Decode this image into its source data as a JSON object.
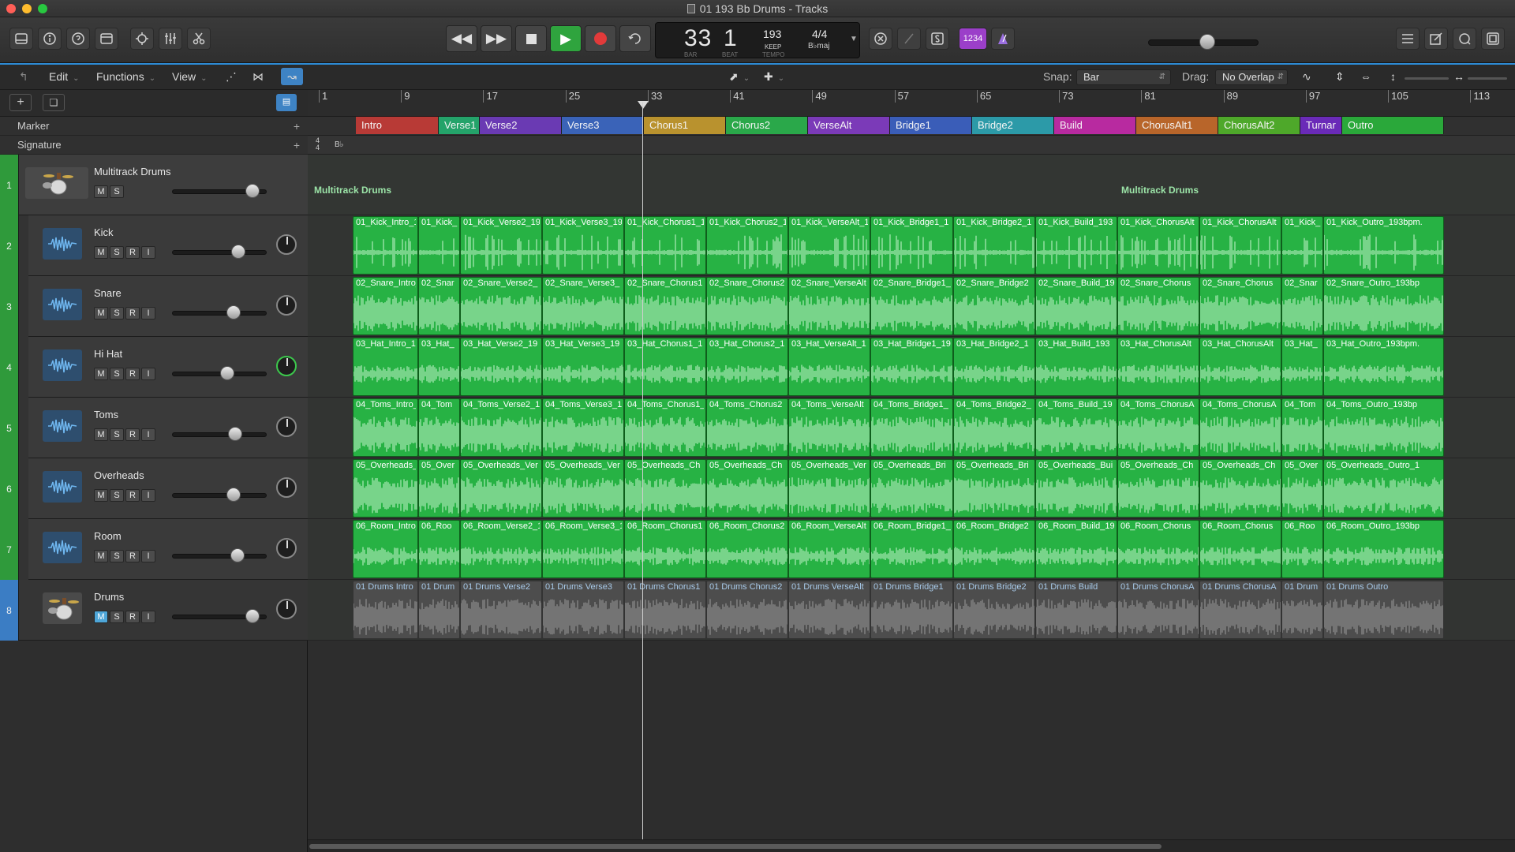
{
  "window": {
    "title": "01 193 Bb Drums - Tracks"
  },
  "transport": {
    "bar": "33",
    "beat": "1",
    "bar_label": "BAR",
    "beat_label": "BEAT",
    "tempo": "193",
    "tempo_mode": "KEEP",
    "tempo_label": "TEMPO",
    "time_signature": "4/4",
    "key": "B♭maj",
    "cycle_count_label": "1234"
  },
  "toolbar": {
    "edit": "Edit",
    "functions": "Functions",
    "view": "View",
    "snap_label": "Snap:",
    "snap_value": "Bar",
    "drag_label": "Drag:",
    "drag_value": "No Overlap"
  },
  "global_tracks": {
    "marker": "Marker",
    "signature": "Signature",
    "signature_value": "4\n4",
    "signature_key": "B♭"
  },
  "ruler": {
    "bars": [
      "1",
      "9",
      "17",
      "25",
      "33",
      "41",
      "49",
      "57",
      "65",
      "73",
      "81",
      "89",
      "97",
      "105",
      "113"
    ]
  },
  "markers": [
    {
      "name": "Intro",
      "color": "#b83a36"
    },
    {
      "name": "Verse1",
      "color": "#24a36a"
    },
    {
      "name": "Verse2",
      "color": "#6a3ab3"
    },
    {
      "name": "Verse3",
      "color": "#3a63b8"
    },
    {
      "name": "Chorus1",
      "color": "#b9922e"
    },
    {
      "name": "Chorus2",
      "color": "#2aa84a"
    },
    {
      "name": "VerseAlt",
      "color": "#7b3ab8"
    },
    {
      "name": "Bridge1",
      "color": "#3a5db8"
    },
    {
      "name": "Bridge2",
      "color": "#2c9aa8"
    },
    {
      "name": "Build",
      "color": "#b82aa0"
    },
    {
      "name": "ChorusAlt1",
      "color": "#b8652a"
    },
    {
      "name": "ChorusAlt2",
      "color": "#4ea82a"
    },
    {
      "name": "Turnar",
      "color": "#6a2ab8"
    },
    {
      "name": "Outro",
      "color": "#2aa83a"
    }
  ],
  "tracks": [
    {
      "num": "1",
      "name": "Multitrack Drums",
      "type": "folder",
      "buttons": [
        "M",
        "S"
      ],
      "fader": 0.85
    },
    {
      "num": "2",
      "name": "Kick",
      "type": "audio",
      "buttons": [
        "M",
        "S",
        "R",
        "I"
      ],
      "fader": 0.7
    },
    {
      "num": "3",
      "name": "Snare",
      "type": "audio",
      "buttons": [
        "M",
        "S",
        "R",
        "I"
      ],
      "fader": 0.65
    },
    {
      "num": "4",
      "name": "Hi Hat",
      "type": "audio",
      "buttons": [
        "M",
        "S",
        "R",
        "I"
      ],
      "fader": 0.58
    },
    {
      "num": "5",
      "name": "Toms",
      "type": "audio",
      "buttons": [
        "M",
        "S",
        "R",
        "I"
      ],
      "fader": 0.67
    },
    {
      "num": "6",
      "name": "Overheads",
      "type": "audio",
      "buttons": [
        "M",
        "S",
        "R",
        "I"
      ],
      "fader": 0.65
    },
    {
      "num": "7",
      "name": "Room",
      "type": "audio",
      "buttons": [
        "M",
        "S",
        "R",
        "I"
      ],
      "fader": 0.69
    },
    {
      "num": "8",
      "name": "Drums",
      "type": "drummer",
      "buttons": [
        "M",
        "S",
        "R",
        "I"
      ],
      "fader": 0.85
    }
  ],
  "folder_region_labels": [
    "Multitrack Drums",
    "Multitrack Drums"
  ],
  "regions": {
    "kick": [
      "01_Kick_Intro_193",
      "01_Kick_",
      "01_Kick_Verse2_19",
      "01_Kick_Verse3_19",
      "01_Kick_Chorus1_1",
      "01_Kick_Chorus2_1",
      "01_Kick_VerseAlt_1",
      "01_Kick_Bridge1_1",
      "01_Kick_Bridge2_1",
      "01_Kick_Build_193",
      "01_Kick_ChorusAlt",
      "01_Kick_ChorusAlt",
      "01_Kick_",
      "01_Kick_Outro_193bpm."
    ],
    "snare": [
      "02_Snare_Intro_19",
      "02_Snar",
      "02_Snare_Verse2_",
      "02_Snare_Verse3_",
      "02_Snare_Chorus1",
      "02_Snare_Chorus2",
      "02_Snare_VerseAlt",
      "02_Snare_Bridge1_",
      "02_Snare_Bridge2",
      "02_Snare_Build_19",
      "02_Snare_Chorus",
      "02_Snare_Chorus",
      "02_Snar",
      "02_Snare_Outro_193bp"
    ],
    "hat": [
      "03_Hat_Intro_193b",
      "03_Hat_",
      "03_Hat_Verse2_19",
      "03_Hat_Verse3_19",
      "03_Hat_Chorus1_1",
      "03_Hat_Chorus2_1",
      "03_Hat_VerseAlt_1",
      "03_Hat_Bridge1_19",
      "03_Hat_Bridge2_1",
      "03_Hat_Build_193",
      "03_Hat_ChorusAlt",
      "03_Hat_ChorusAlt",
      "03_Hat_",
      "03_Hat_Outro_193bpm."
    ],
    "toms": [
      "04_Toms_Intro_19",
      "04_Tom",
      "04_Toms_Verse2_1",
      "04_Toms_Verse3_1",
      "04_Toms_Chorus1_",
      "04_Toms_Chorus2",
      "04_Toms_VerseAlt",
      "04_Toms_Bridge1_",
      "04_Toms_Bridge2_",
      "04_Toms_Build_19",
      "04_Toms_ChorusA",
      "04_Toms_ChorusA",
      "04_Tom",
      "04_Toms_Outro_193bp"
    ],
    "overheads": [
      "05_Overheads_Intr",
      "05_Over",
      "05_Overheads_Ver",
      "05_Overheads_Ver",
      "05_Overheads_Ch",
      "05_Overheads_Ch",
      "05_Overheads_Ver",
      "05_Overheads_Bri",
      "05_Overheads_Bri",
      "05_Overheads_Bui",
      "05_Overheads_Ch",
      "05_Overheads_Ch",
      "05_Over",
      "05_Overheads_Outro_1"
    ],
    "room": [
      "06_Room_Intro_19",
      "06_Roo",
      "06_Room_Verse2_1",
      "06_Room_Verse3_1",
      "06_Room_Chorus1",
      "06_Room_Chorus2",
      "06_Room_VerseAlt",
      "06_Room_Bridge1_",
      "06_Room_Bridge2",
      "06_Room_Build_19",
      "06_Room_Chorus",
      "06_Room_Chorus",
      "06_Roo",
      "06_Room_Outro_193bp"
    ],
    "drums": [
      "01 Drums Intro",
      "01 Drum",
      "01 Drums Verse2",
      "01 Drums Verse3",
      "01 Drums Chorus1",
      "01 Drums Chorus2",
      "01 Drums VerseAlt",
      "01 Drums Bridge1",
      "01 Drums Bridge2",
      "01 Drums Build",
      "01 Drums ChorusA",
      "01 Drums ChorusA",
      "01 Drum",
      "01 Drums Outro"
    ]
  },
  "colors": {
    "region_green": "#27b244",
    "drummer_gray": "#4d4d4d",
    "accent_blue": "#2d8bd5"
  }
}
